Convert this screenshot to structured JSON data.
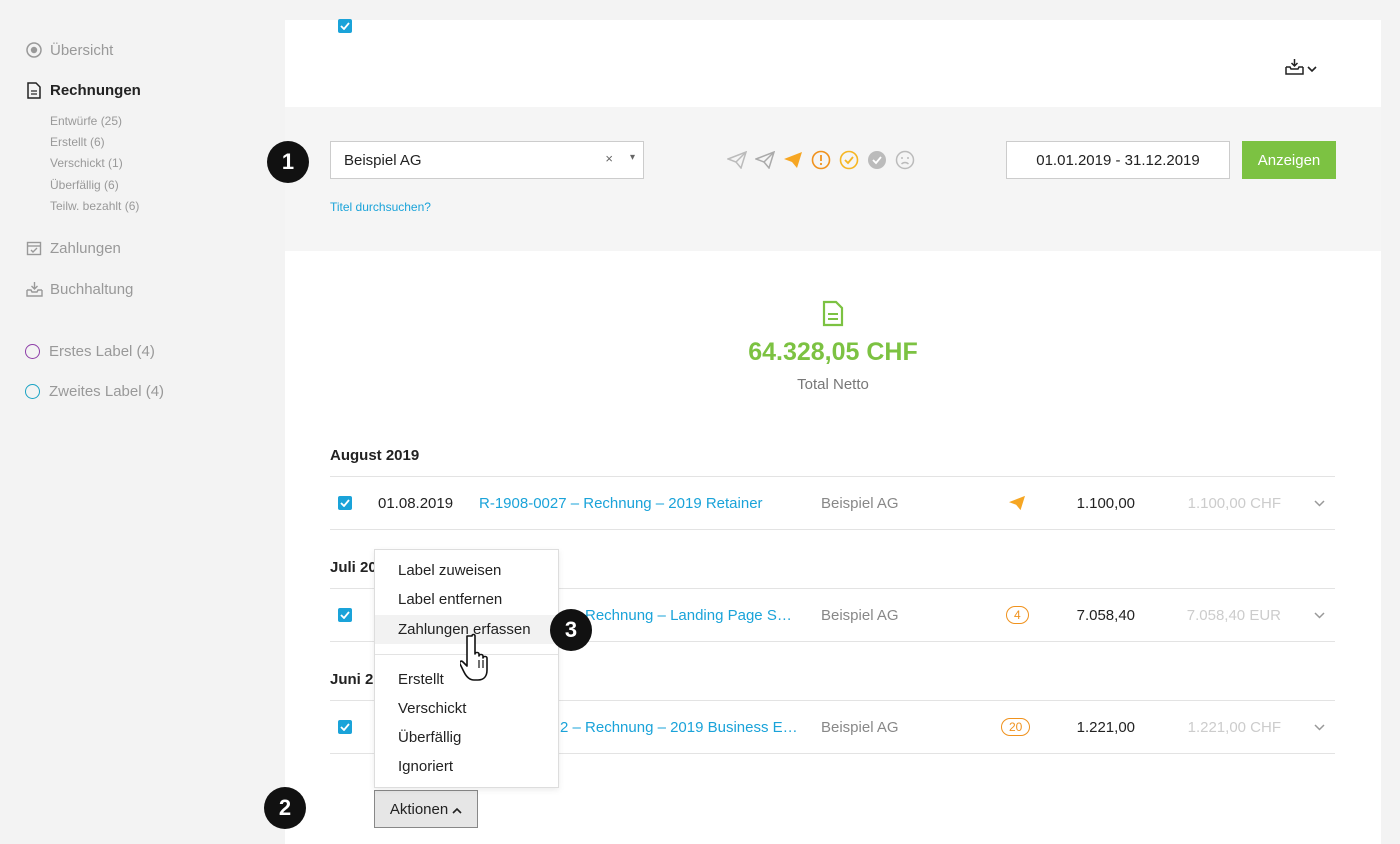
{
  "sidebar": {
    "overview": "Übersicht",
    "invoices": "Rechnungen",
    "sub_items": [
      "Entwürfe (25)",
      "Erstellt (6)",
      "Verschickt (1)",
      "Überfällig (6)",
      "Teilw. bezahlt (6)"
    ],
    "payments": "Zahlungen",
    "accounting": "Buchhaltung",
    "labels": [
      {
        "name": "Erstes Label (4)",
        "color": "#8e3ea8"
      },
      {
        "name": "Zweites Label (4)",
        "color": "#1aa3c4"
      }
    ]
  },
  "filter": {
    "customer": "Beispiel AG",
    "clear_symbol": "×",
    "arrow_symbol": "▾",
    "date_range": "01.01.2019 - 31.12.2019",
    "show_button": "Anzeigen",
    "search_link": "Titel durchsuchen?",
    "status_icons": [
      "draft-send-icon",
      "created-send-icon",
      "sent-icon",
      "overdue-icon",
      "paid-icon",
      "completed-icon",
      "ignored-icon"
    ]
  },
  "summary": {
    "total": "64.328,05 CHF",
    "label": "Total Netto"
  },
  "groups": [
    {
      "month": "August 2019",
      "date": "01.08.2019",
      "title": "R-1908-0027 – Rechnung – 2019 Retainer",
      "customer": "Beispiel AG",
      "status": "sent-icon",
      "net": "1.100,00",
      "gross": "1.100,00 CHF"
    },
    {
      "month": "Juli 20",
      "date": "",
      "title": "Rechnung – Landing Page S…",
      "customer": "Beispiel AG",
      "status": "4",
      "net": "7.058,40",
      "gross": "7.058,40 EUR"
    },
    {
      "month": "Juni 2",
      "date": "",
      "title": "2 – Rechnung – 2019 Business E…",
      "customer": "Beispiel AG",
      "status": "20",
      "net": "1.221,00",
      "gross": "1.221,00 CHF"
    }
  ],
  "actions": {
    "button": "Aktionen",
    "menu": [
      "Label zuweisen",
      "Label entfernen",
      "Zahlungen erfassen",
      "Erstellt",
      "Verschickt",
      "Überfällig",
      "Ignoriert"
    ]
  },
  "callouts": [
    "1",
    "2",
    "3"
  ],
  "colors": {
    "accent_green": "#7cc242",
    "link_blue": "#1aa3d9",
    "warning_orange": "#f0921d"
  }
}
